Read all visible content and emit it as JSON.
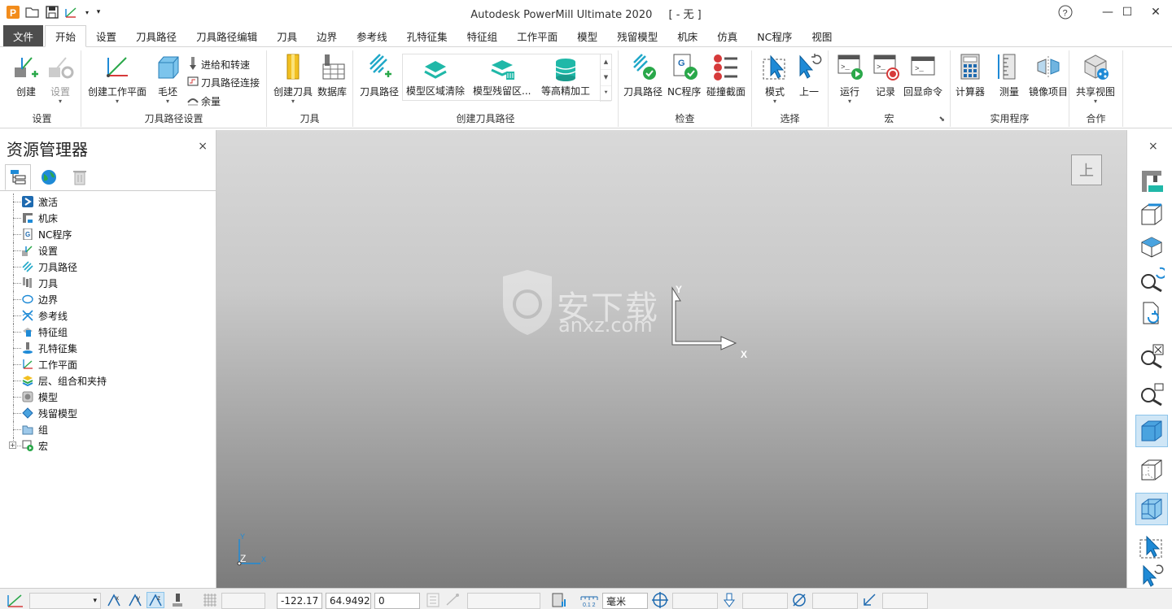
{
  "titlebar": {
    "app_title": "Autodesk PowerMill Ultimate 2020",
    "doc_title": "[ - 无 ]",
    "help": "?",
    "minimize": "—",
    "maximize": "☐",
    "close": "✕"
  },
  "menu": {
    "file": "文件",
    "tabs": [
      "开始",
      "设置",
      "刀具路径",
      "刀具路径编辑",
      "刀具",
      "边界",
      "参考线",
      "孔特征集",
      "特征组",
      "工作平面",
      "模型",
      "残留模型",
      "机床",
      "仿真",
      "NC程序",
      "视图"
    ]
  },
  "ribbon": {
    "setup": {
      "label": "设置",
      "create": "创建",
      "settings": "设置"
    },
    "toolpath_setup": {
      "label": "刀具路径设置",
      "create_workplane": "创建工作平面",
      "block": "毛坯",
      "feeds_speeds": "进给和转速",
      "toolpath_connections": "刀具路径连接",
      "thickness": "余量"
    },
    "tools": {
      "label": "刀具",
      "create_tool": "创建刀具",
      "database": "数据库"
    },
    "create_toolpath": {
      "label": "创建刀具路径",
      "toolpath": "刀具路径",
      "model_area_clearance": "模型区域清除",
      "model_rest_area": "模型残留区...",
      "constant_z_finishing": "等高精加工"
    },
    "verify": {
      "label": "检查",
      "toolpath": "刀具路径",
      "nc_program": "NC程序",
      "collision_section": "碰撞截面"
    },
    "select": {
      "label": "选择",
      "mode": "模式",
      "previous": "上一"
    },
    "macro": {
      "label": "宏",
      "run": "运行",
      "record": "记录",
      "echo_commands": "回显命令"
    },
    "utilities": {
      "label": "实用程序",
      "calculator": "计算器",
      "measure": "测量",
      "mirror": "镜像项目"
    },
    "collaborate": {
      "label": "合作",
      "share_view": "共享视图"
    }
  },
  "explorer": {
    "title": "资源管理器",
    "close": "×",
    "items": [
      "激活",
      "机床",
      "NC程序",
      "设置",
      "刀具路径",
      "刀具",
      "边界",
      "参考线",
      "特征组",
      "孔特征集",
      "工作平面",
      "层、组合和夹持",
      "模型",
      "残留模型",
      "组",
      "宏"
    ]
  },
  "viewport": {
    "view_cube_label": "上",
    "axis_x": "X",
    "axis_y": "Y",
    "small_axis_y": "Y",
    "small_axis_z": "Z",
    "small_axis_x": "X",
    "watermark": "安下载",
    "watermark_sub": "anxz.com"
  },
  "righttools": {
    "close": "×"
  },
  "statusbar": {
    "coord_x": "-122.17",
    "coord_y": "64.9492",
    "coord_z": "0",
    "units": "毫米"
  },
  "colors": {
    "accent_blue": "#1e8ad6",
    "green": "#2aa84a",
    "red": "#d63a3a",
    "teal": "#20b8a8",
    "file_tab": "#4d4d4d"
  }
}
